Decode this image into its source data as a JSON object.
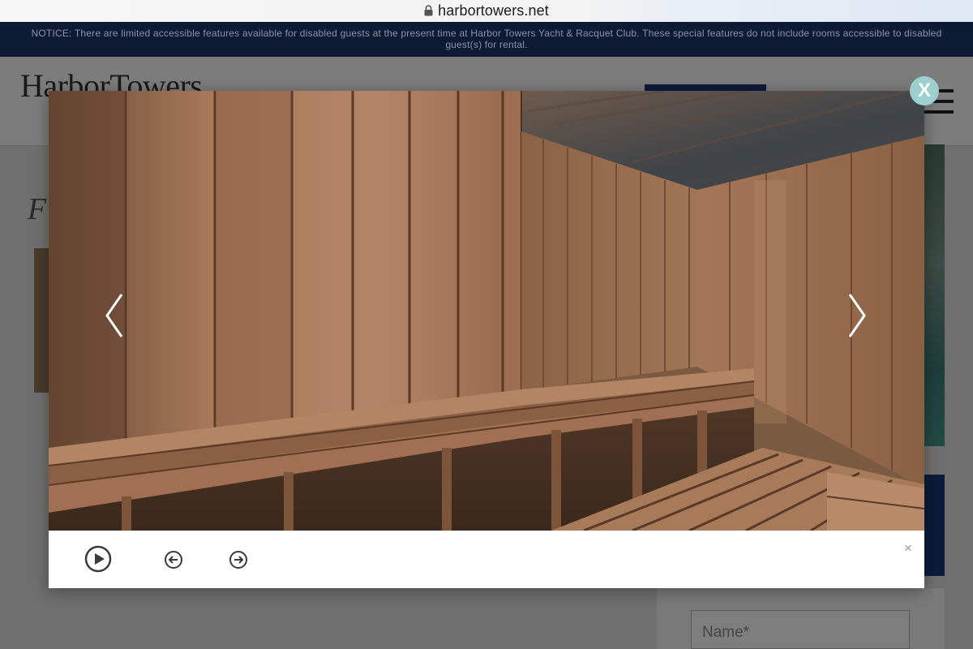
{
  "browser": {
    "url": "harbortowers.net"
  },
  "notice": {
    "text": "NOTICE: There are limited accessible features available for disabled guests at the present time at Harbor Towers Yacht & Racquet Club. These special features do not include rooms accessible to disabled guest(s) for rental."
  },
  "site": {
    "logo": "HarborTowers",
    "heading_partial": "F"
  },
  "form": {
    "name_placeholder": "Name*"
  },
  "lightbox": {
    "close_label": "X",
    "toolbar_close": "×",
    "photo_subject": "wooden sauna interior with benches",
    "icons": {
      "prev": "chevron-left-icon",
      "next": "chevron-right-icon",
      "play": "play-circle-icon",
      "thumb_prev": "arrow-left-circle-icon",
      "thumb_next": "arrow-right-circle-icon"
    }
  },
  "colors": {
    "notice_bg": "#0d1a33",
    "brand_navy": "#0c1b3a",
    "close_button": "#9ecfcf",
    "wood": "#9a6d4b"
  }
}
